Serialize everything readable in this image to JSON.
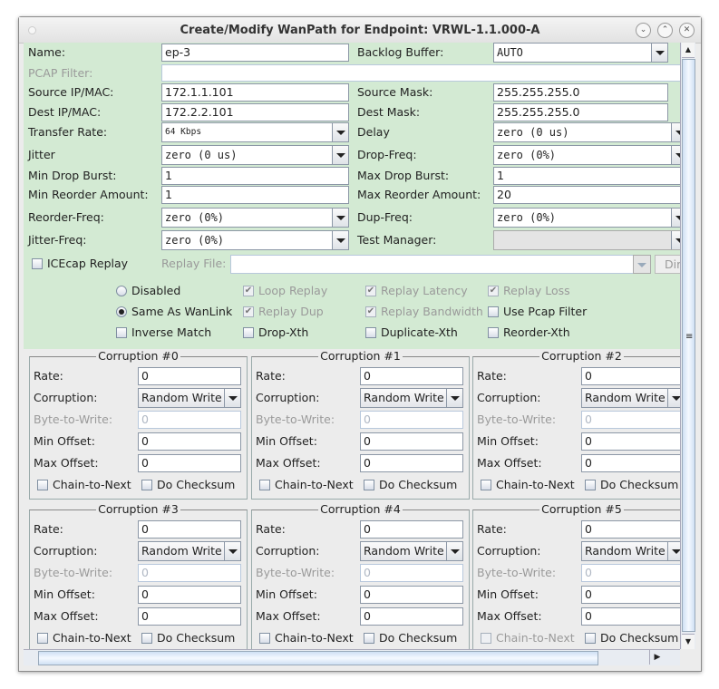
{
  "window": {
    "title": "Create/Modify WanPath for Endpoint: VRWL-1.1.000-A",
    "controls": [
      "minimize",
      "maximize",
      "close"
    ]
  },
  "form": {
    "name": {
      "label": "Name:",
      "value": "ep-3"
    },
    "backlog": {
      "label": "Backlog Buffer:",
      "value": "AUTO"
    },
    "pcap_filter": {
      "label": "PCAP Filter:",
      "value": ""
    },
    "source_ip": {
      "label": "Source IP/MAC:",
      "value": "172.1.1.101"
    },
    "source_mask": {
      "label": "Source Mask:",
      "value": "255.255.255.0"
    },
    "dest_ip": {
      "label": "Dest IP/MAC:",
      "value": "172.2.2.101"
    },
    "dest_mask": {
      "label": "Dest Mask:",
      "value": "255.255.255.0"
    },
    "transfer_rate": {
      "label": "Transfer Rate:",
      "value": "64 Kbps"
    },
    "delay": {
      "label": "Delay",
      "value": "zero (0 us)"
    },
    "jitter": {
      "label": "Jitter",
      "value": "zero (0 us)"
    },
    "drop_freq": {
      "label": "Drop-Freq:",
      "value": "zero (0%)"
    },
    "min_drop_burst": {
      "label": "Min Drop Burst:",
      "value": "1"
    },
    "max_drop_burst": {
      "label": "Max Drop Burst:",
      "value": "1"
    },
    "min_reorder": {
      "label": "Min Reorder Amount:",
      "value": "1"
    },
    "max_reorder": {
      "label": "Max Reorder Amount:",
      "value": "20"
    },
    "reorder_freq": {
      "label": "Reorder-Freq:",
      "value": "zero (0%)"
    },
    "dup_freq": {
      "label": "Dup-Freq:",
      "value": "zero (0%)"
    },
    "jitter_freq": {
      "label": "Jitter-Freq:",
      "value": "zero (0%)"
    },
    "test_manager": {
      "label": "Test Manager:",
      "value": ""
    },
    "icecap": {
      "label": "ICEcap Replay",
      "checked": false
    },
    "replay_file": {
      "label": "Replay File:",
      "value": "",
      "button": "Dir"
    }
  },
  "options": {
    "disabled": {
      "label": "Disabled",
      "selected": false
    },
    "same_as_wanlink": {
      "label": "Same As WanLink",
      "selected": true
    },
    "inverse_match": {
      "label": "Inverse Match",
      "checked": false
    },
    "loop_replay": {
      "label": "Loop Replay",
      "checked": true,
      "disabled": true
    },
    "replay_dup": {
      "label": "Replay Dup",
      "checked": true,
      "disabled": true
    },
    "drop_xth": {
      "label": "Drop-Xth",
      "checked": false
    },
    "replay_latency": {
      "label": "Replay Latency",
      "checked": true,
      "disabled": true
    },
    "replay_bandwidth": {
      "label": "Replay Bandwidth",
      "checked": true,
      "disabled": true
    },
    "duplicate_xth": {
      "label": "Duplicate-Xth",
      "checked": false
    },
    "replay_loss": {
      "label": "Replay Loss",
      "checked": true,
      "disabled": true
    },
    "use_pcap_filter": {
      "label": "Use Pcap Filter",
      "checked": false
    },
    "reorder_xth": {
      "label": "Reorder-Xth",
      "checked": false
    }
  },
  "corruption_labels": {
    "rate": "Rate:",
    "corruption": "Corruption:",
    "byte": "Byte-to-Write:",
    "min": "Min Offset:",
    "max": "Max Offset:",
    "chain": "Chain-to-Next",
    "checksum": "Do Checksum"
  },
  "corruptions": [
    {
      "title": "Corruption #0",
      "rate": "0",
      "type": "Random Write",
      "byte": "0",
      "min": "0",
      "max": "0",
      "chain_disabled": false
    },
    {
      "title": "Corruption #1",
      "rate": "0",
      "type": "Random Write",
      "byte": "0",
      "min": "0",
      "max": "0",
      "chain_disabled": false
    },
    {
      "title": "Corruption #2",
      "rate": "0",
      "type": "Random Write",
      "byte": "0",
      "min": "0",
      "max": "0",
      "chain_disabled": false
    },
    {
      "title": "Corruption #3",
      "rate": "0",
      "type": "Random Write",
      "byte": "0",
      "min": "0",
      "max": "0",
      "chain_disabled": false
    },
    {
      "title": "Corruption #4",
      "rate": "0",
      "type": "Random Write",
      "byte": "0",
      "min": "0",
      "max": "0",
      "chain_disabled": false
    },
    {
      "title": "Corruption #5",
      "rate": "0",
      "type": "Random Write",
      "byte": "0",
      "min": "0",
      "max": "0",
      "chain_disabled": true
    }
  ],
  "colors": {
    "form_bg": "#d3ead3",
    "panel_bg": "#ececec"
  }
}
